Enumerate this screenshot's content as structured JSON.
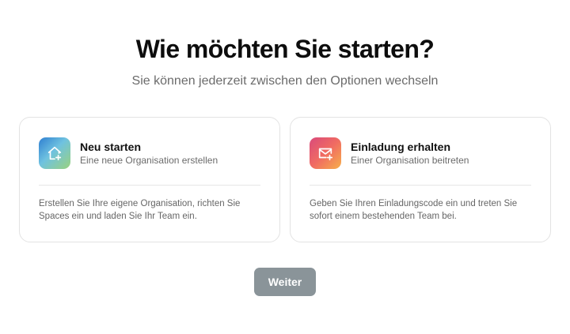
{
  "header": {
    "title": "Wie möchten Sie starten?",
    "subtitle": "Sie können jederzeit zwischen den Optionen wechseln"
  },
  "options": [
    {
      "icon": "home-plus-icon",
      "title": "Neu starten",
      "subtitle": "Eine neue Organisation erstellen",
      "description": "Erstellen Sie Ihre eigene Organisation, richten Sie Spaces ein und laden Sie Ihr Team ein."
    },
    {
      "icon": "mail-plus-icon",
      "title": "Einladung erhalten",
      "subtitle": "Einer Organisation beitreten",
      "description": "Geben Sie Ihren Einladungscode ein und treten Sie sofort einem bestehenden Team bei."
    }
  ],
  "footer": {
    "continue_label": "Weiter"
  },
  "colors": {
    "button_bg": "#8a9499",
    "card_border": "#e3e3e3"
  }
}
